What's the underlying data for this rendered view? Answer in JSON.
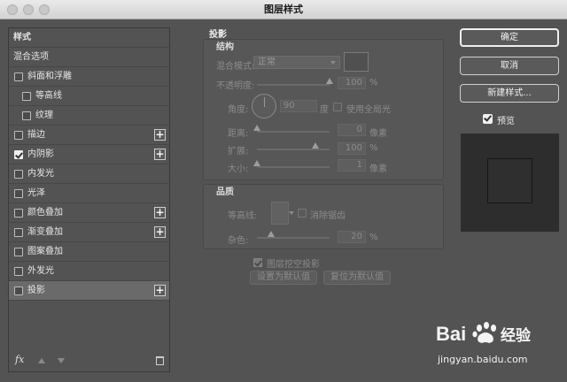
{
  "window": {
    "title": "图层样式"
  },
  "style_list": {
    "items": [
      {
        "label": "样式",
        "type": "header"
      },
      {
        "label": "混合选项",
        "type": "plain"
      },
      {
        "label": "斜面和浮雕",
        "type": "checkbox",
        "checked": false,
        "add": false
      },
      {
        "label": "等高线",
        "type": "sub",
        "checked": false
      },
      {
        "label": "纹理",
        "type": "sub",
        "checked": false
      },
      {
        "label": "描边",
        "type": "checkbox",
        "checked": false,
        "add": true
      },
      {
        "label": "内阴影",
        "type": "checkbox",
        "checked": true,
        "add": true
      },
      {
        "label": "内发光",
        "type": "checkbox",
        "checked": false,
        "add": false
      },
      {
        "label": "光泽",
        "type": "checkbox",
        "checked": false,
        "add": false
      },
      {
        "label": "颜色叠加",
        "type": "checkbox",
        "checked": false,
        "add": true
      },
      {
        "label": "渐变叠加",
        "type": "checkbox",
        "checked": false,
        "add": true
      },
      {
        "label": "图案叠加",
        "type": "checkbox",
        "checked": false,
        "add": false
      },
      {
        "label": "外发光",
        "type": "checkbox",
        "checked": false,
        "add": false
      },
      {
        "label": "投影",
        "type": "checkbox",
        "checked": false,
        "add": true,
        "selected": true
      }
    ],
    "footer": {
      "fx_label": "fx",
      "icons": [
        "move-up-icon",
        "move-down-icon",
        "trash-icon"
      ]
    }
  },
  "drop_shadow": {
    "title": "投影",
    "structure": {
      "title": "结构",
      "blend_mode_label": "混合模式:",
      "blend_mode_value": "正常",
      "opacity_label": "不透明度:",
      "opacity_value": "100",
      "opacity_unit": "%",
      "opacity_level": 1.0,
      "angle_label": "角度:",
      "angle_value": "90",
      "angle_unit": "度",
      "global_light_label": "使用全局光",
      "global_light_checked": false,
      "distance_label": "距离:",
      "distance_value": "0",
      "distance_unit": "像素",
      "spread_label": "扩展:",
      "spread_value": "100",
      "spread_unit": "%",
      "size_label": "大小:",
      "size_value": "1",
      "size_unit": "像素"
    },
    "quality": {
      "title": "品质",
      "contour_label": "等高线:",
      "anti_alias_label": "消除锯齿",
      "anti_alias_checked": false,
      "noise_label": "杂色:",
      "noise_value": "20",
      "noise_unit": "%"
    },
    "knockout_label": "图层挖空投影",
    "knockout_checked": true,
    "set_default_label": "设置为默认值",
    "reset_default_label": "复位为默认值"
  },
  "actions": {
    "ok_label": "确定",
    "cancel_label": "取消",
    "new_style_label": "新建样式...",
    "preview_label": "预览",
    "preview_checked": true
  },
  "watermark": {
    "logo_text": "Bai 经验",
    "url_text": "jingyan.baidu.com"
  }
}
